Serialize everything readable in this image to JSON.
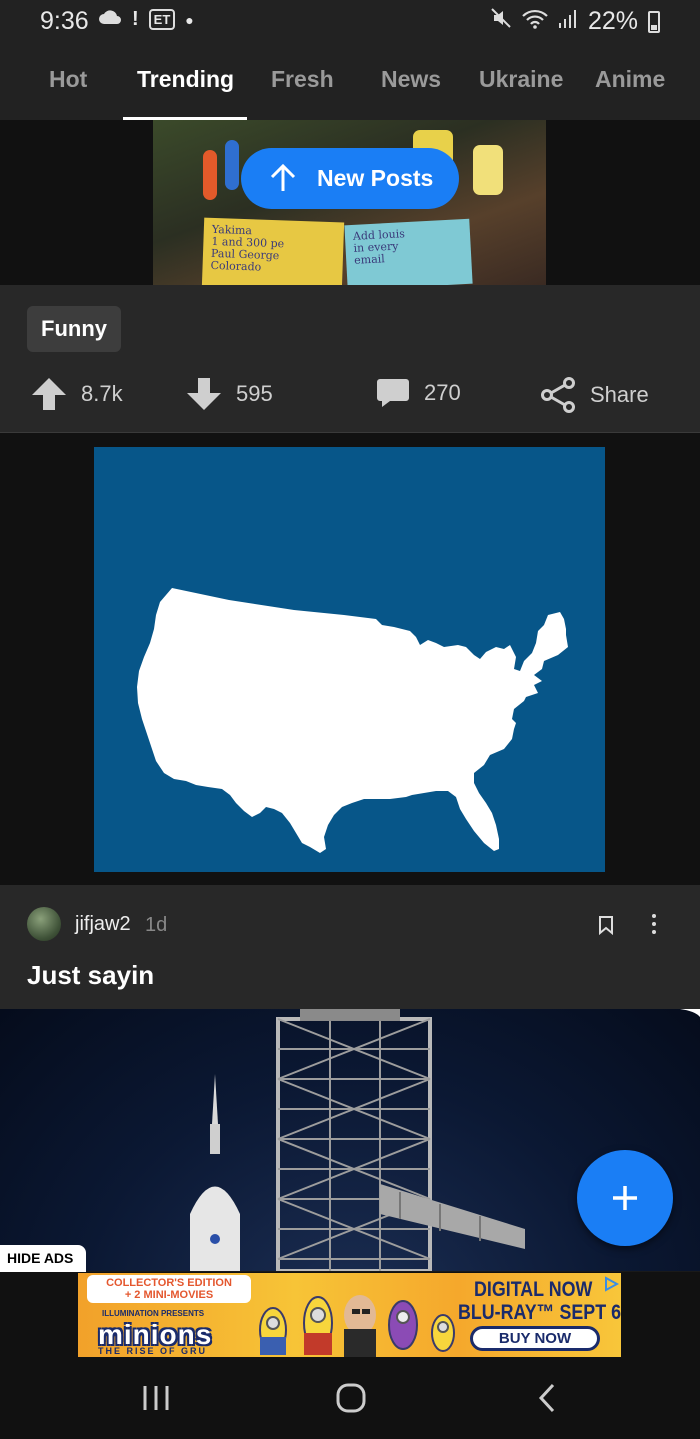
{
  "status_bar": {
    "time": "9:36",
    "carrier_badge": "ET",
    "battery": "22%",
    "icons": [
      "cloud-icon",
      "notification-icon",
      "mute-icon",
      "wifi-icon",
      "signal-icon",
      "battery-icon"
    ]
  },
  "tabs": [
    {
      "label": "Hot",
      "active": false
    },
    {
      "label": "Trending",
      "active": true
    },
    {
      "label": "Fresh",
      "active": false
    },
    {
      "label": "News",
      "active": false
    },
    {
      "label": "Ukraine",
      "active": false
    },
    {
      "label": "Anime",
      "active": false
    }
  ],
  "new_posts_button": {
    "label": "New Posts"
  },
  "post1": {
    "sticky_note_1": "Yakima\n1 and 300 pe\nPaul George\nColorado",
    "sticky_note_2": "Add louis\nin every\nemail",
    "tag": "Funny",
    "upvotes": "8.7k",
    "downvotes": "595",
    "comments": "270",
    "share_label": "Share"
  },
  "post3": {
    "username": "jifjaw2",
    "age": "1d",
    "title": "Just sayin"
  },
  "ads": {
    "hide_label": "HIDE ADS",
    "collector_line1": "COLLECTOR'S EDITION",
    "collector_line2": "+ 2 MINI-MOVIES",
    "presenter": "ILLUMINATION PRESENTS",
    "title": "minions",
    "subtitle": "THE RISE OF GRU",
    "digital": "DIGITAL NOW",
    "bluray": "BLU-RAY™ SEPT 6",
    "buy": "BUY NOW"
  },
  "colors": {
    "accent_blue": "#1a7ef5",
    "map_background": "#075689",
    "card_background": "#282828"
  }
}
